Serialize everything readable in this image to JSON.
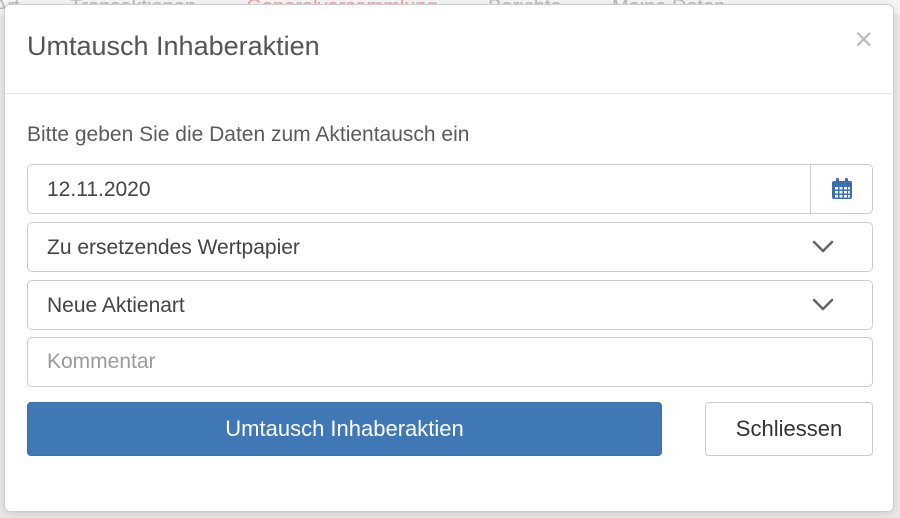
{
  "background": {
    "nav_items": [
      "Art",
      "Transaktionen",
      "Generalversammlung",
      "Berichte",
      "Meine Daten"
    ]
  },
  "modal": {
    "title": "Umtausch Inhaberaktien",
    "close_label": "×",
    "intro": "Bitte geben Sie die Daten zum Aktientausch ein",
    "date": {
      "value": "12.11.2020",
      "icon": "calendar-icon"
    },
    "select_security": {
      "value": "Zu ersetzendes Wertpapier",
      "icon": "chevron-down-icon"
    },
    "select_share_type": {
      "value": "Neue Aktienart",
      "icon": "chevron-down-icon"
    },
    "comment": {
      "placeholder": "Kommentar",
      "value": ""
    },
    "primary_button": "Umtausch Inhaberaktien",
    "secondary_button": "Schliessen"
  },
  "colors": {
    "primary": "#3f78b5",
    "calendar_icon": "#3a6fb0",
    "text": "#555555",
    "nav_highlight": "#e7a3a3"
  }
}
